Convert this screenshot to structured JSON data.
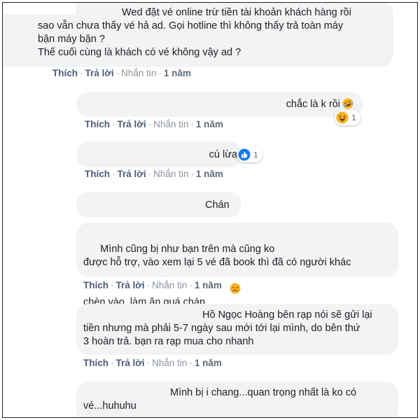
{
  "comments": [
    {
      "text": "Wed đặt vé online trừ tiền tài khoản khách hàng rồi\nsao vẫn chưa thấy vé hả ad. Gọi hotline thì không thấy trả toàn máy\nbận máy bận ?\nThế cuối cùng là khách có vé không vậy ad ?",
      "actions": {
        "like": "Thích",
        "reply": "Trả lời",
        "message": "Nhắn tin",
        "time": "1 năm"
      }
    },
    {
      "text": "chắc là k rồi",
      "emoji": "laughing-crying-emoji-icon",
      "reaction": {
        "icon": "haha-reaction-icon",
        "count": "1"
      },
      "actions": {
        "like": "Thích",
        "reply": "Trả lời",
        "message": "Nhắn tin",
        "time": "1 năm"
      }
    },
    {
      "text": "cú lừa",
      "reaction": {
        "icon": "like-reaction-icon",
        "count": "1"
      },
      "actions": {
        "like": "Thích",
        "reply": "Trả lời",
        "message": "Nhắn tin",
        "time": "1 năm"
      }
    },
    {
      "text": "Chán"
    },
    {
      "text": "Mình cũng bị như bạn trên mà cũng ko\nđược hỗ trợ, vào xem lại 5 vé đã book thì đã có người khác\nchèn vào, làm ăn quá chán",
      "emoji": "sad-face-emoji-icon",
      "actions": {
        "like": "Thích",
        "reply": "Trả lời",
        "message": "Nhắn tin",
        "time": "1 năm"
      }
    },
    {
      "text": "Hồ Ngọc Hoàng bên rạp nói sẽ gửi lại\ntiền nhưng mà phải 5-7 ngày sau mới tới lại mình, do bên thứ\n3 hoàn trả. bạn ra rạp mua cho nhanh",
      "actions": {
        "like": "Thích",
        "reply": "Trả lời",
        "message": "Nhắn tin",
        "time": "1 năm"
      }
    },
    {
      "text": "Mình bị i chang...quan trọng nhất là ko có\nvé...huhuhu"
    }
  ],
  "colors": {
    "bubble": "#f2f3f5",
    "action_link": "#4b5c78",
    "like_blue": "#1877f2",
    "haha_yellow": "#f7b125"
  },
  "separator": "·"
}
